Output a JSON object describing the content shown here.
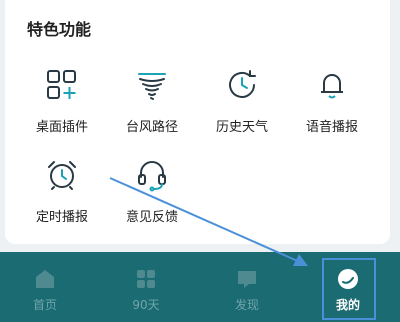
{
  "section": {
    "title": "特色功能"
  },
  "features": [
    {
      "label": "桌面插件",
      "icon": "widget-add-icon"
    },
    {
      "label": "台风路径",
      "icon": "typhoon-icon"
    },
    {
      "label": "历史天气",
      "icon": "history-clock-icon"
    },
    {
      "label": "语音播报",
      "icon": "bell-icon"
    },
    {
      "label": "定时播报",
      "icon": "alarm-clock-icon"
    },
    {
      "label": "意见反馈",
      "icon": "headset-icon"
    }
  ],
  "tabs": [
    {
      "label": "首页",
      "icon": "home-icon"
    },
    {
      "label": "90天",
      "icon": "grid-icon"
    },
    {
      "label": "发现",
      "icon": "chat-icon"
    },
    {
      "label": "我的",
      "icon": "profile-icon",
      "active": true
    }
  ],
  "colors": {
    "tabbar_bg": "#1b6b72",
    "tab_inactive": "#6fa5aa",
    "tab_active": "#ffffff",
    "icon_dark": "#2a3a44",
    "accent": "#1aa3b4",
    "annotation": "#4a90d9"
  }
}
